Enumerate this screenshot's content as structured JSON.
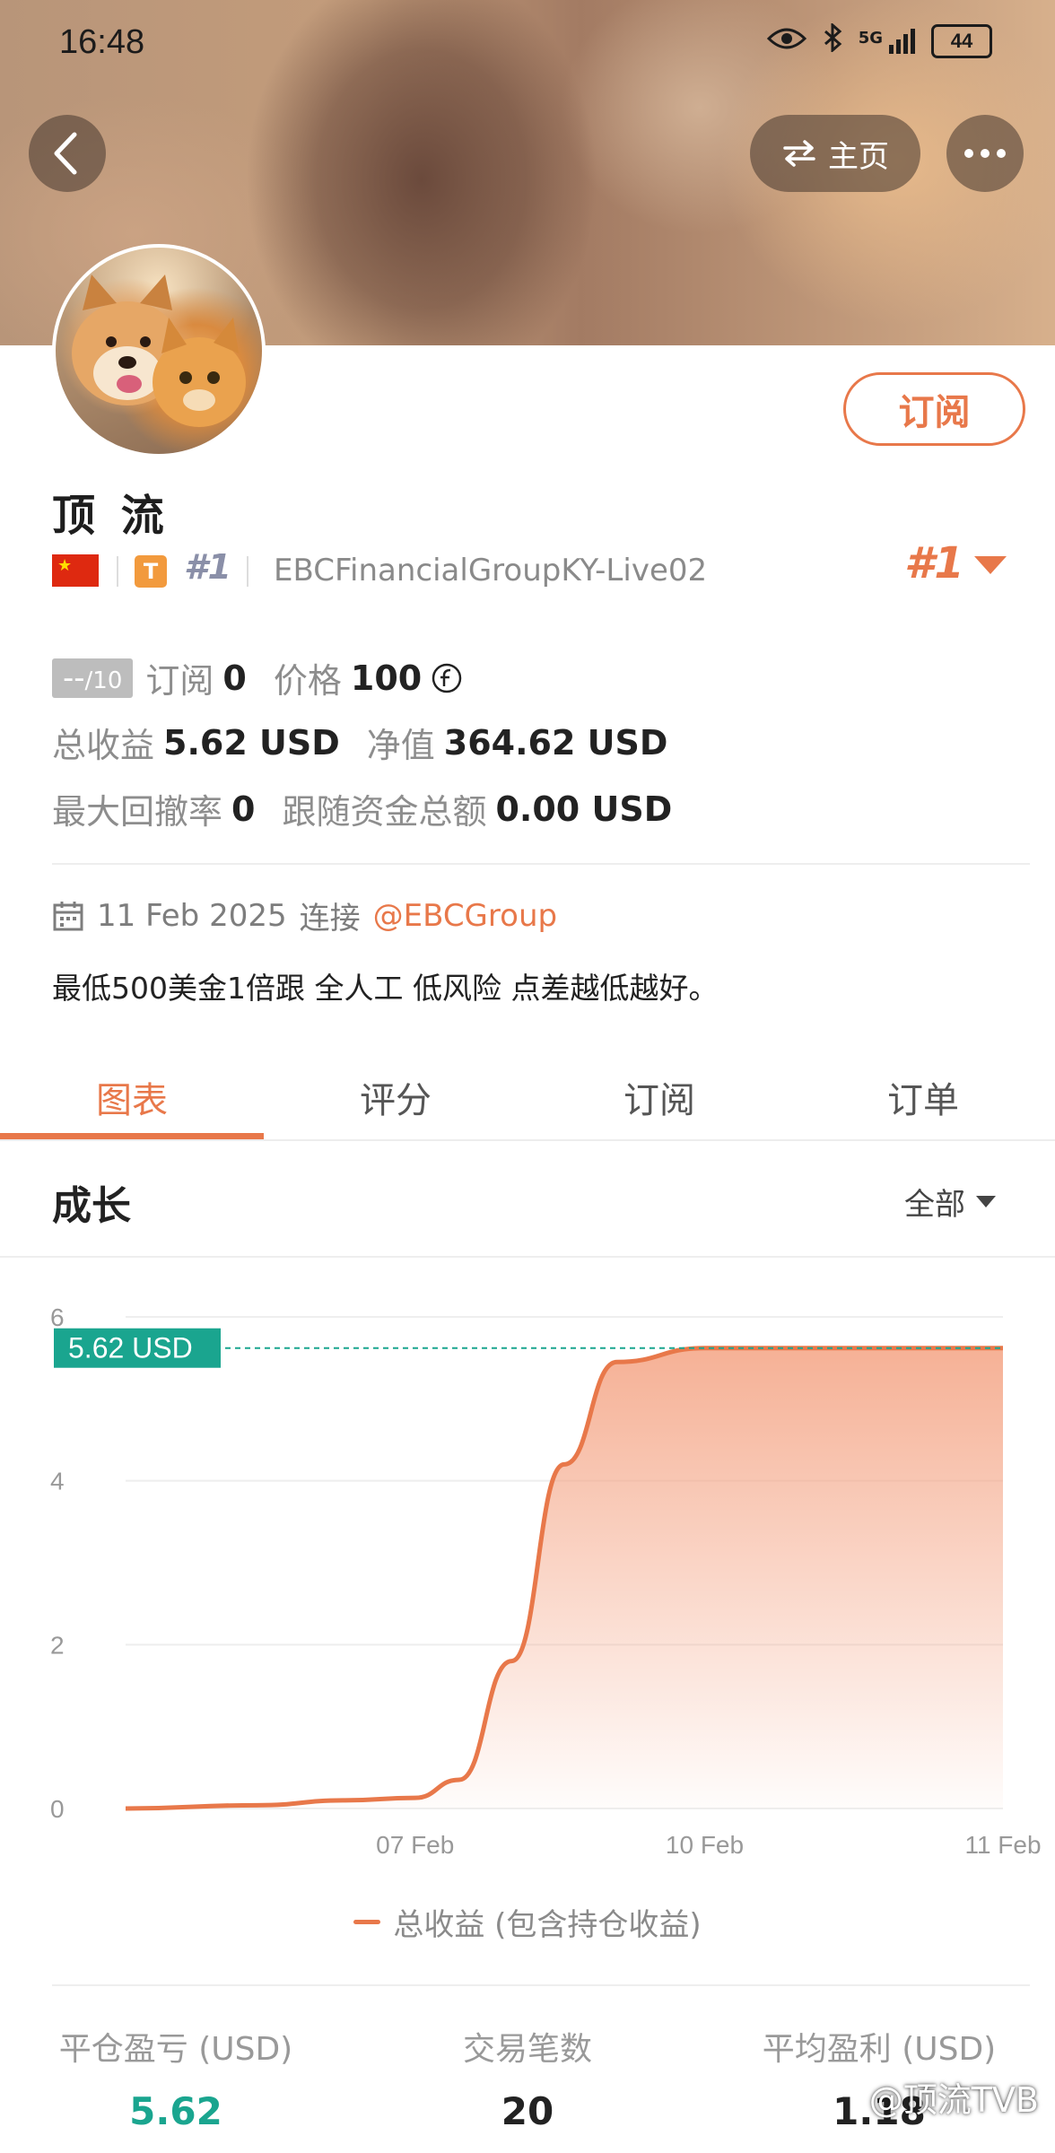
{
  "status_bar": {
    "time": "16:48",
    "signal": "5G",
    "battery": "44"
  },
  "nav": {
    "home_label": "主页"
  },
  "profile": {
    "name": "顶 流",
    "rank_badge": "#1",
    "t_badge": "T",
    "server": "EBCFinancialGroupKY-Live02",
    "rank_big": "#1",
    "subscribe_label": "订阅"
  },
  "stats": {
    "score": "--",
    "score_max": "/10",
    "subscribe_label": "订阅",
    "subscribe_count": "0",
    "price_label": "价格",
    "price_value": "100",
    "total_label": "总收益",
    "total_value": "5.62 USD",
    "equity_label": "净值",
    "equity_value": "364.62 USD",
    "drawdown_label": "最大回撤率",
    "drawdown_value": "0",
    "follow_label": "跟随资金总额",
    "follow_value": "0.00 USD"
  },
  "connection": {
    "date": "11 Feb 2025",
    "label": "连接",
    "broker": "@EBCGroup"
  },
  "description": "最低500美金1倍跟 全人工 低风险 点差越低越好。",
  "tabs": [
    "图表",
    "评分",
    "订阅",
    "订单"
  ],
  "section": {
    "title": "成长",
    "filter": "全部"
  },
  "chart_data": {
    "type": "area",
    "x_ticks": [
      "07 Feb",
      "10 Feb",
      "11 Feb"
    ],
    "y_ticks": [
      "0",
      "2",
      "4",
      "6"
    ],
    "ylim": [
      0,
      6
    ],
    "current_label": "5.62 USD",
    "current_value": 5.62,
    "series": [
      {
        "name": "总收益 (包含持仓收益)",
        "points": [
          [
            0,
            0.0
          ],
          [
            0.15,
            0.04
          ],
          [
            0.25,
            0.1
          ],
          [
            0.33,
            0.13
          ],
          [
            0.38,
            0.35
          ],
          [
            0.44,
            1.8
          ],
          [
            0.5,
            4.2
          ],
          [
            0.56,
            5.45
          ],
          [
            0.66,
            5.62
          ],
          [
            1.0,
            5.62
          ]
        ]
      }
    ],
    "line_color": "#e8784a",
    "label_color": "#1aa58f"
  },
  "legend_label": "总收益 (包含持仓收益)",
  "summary": [
    {
      "label": "平仓盈亏 (USD)",
      "value": "5.62"
    },
    {
      "label": "交易笔数",
      "value": "20"
    },
    {
      "label": "平均盈利 (USD)",
      "value": "1.18"
    }
  ],
  "watermark": "@顶流TVB"
}
